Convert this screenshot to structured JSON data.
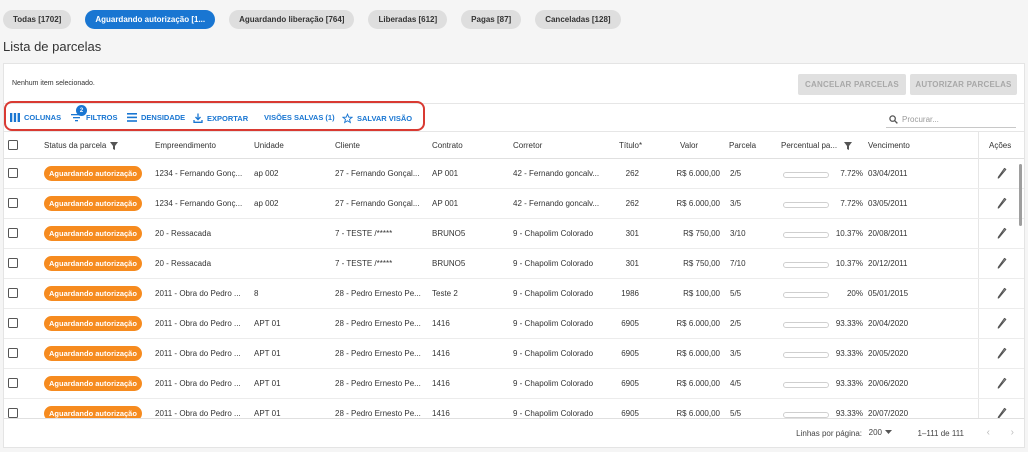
{
  "tabs": [
    {
      "label": "Todas [1702]",
      "active": false
    },
    {
      "label": "Aguardando autorização [1...",
      "active": true
    },
    {
      "label": "Aguardando liberação [764]",
      "active": false
    },
    {
      "label": "Liberadas [612]",
      "active": false
    },
    {
      "label": "Pagas [87]",
      "active": false
    },
    {
      "label": "Canceladas [128]",
      "active": false
    }
  ],
  "page_title": "Lista de parcelas",
  "selection": {
    "message": "Nenhum item selecionado.",
    "cancel_label": "CANCELAR PARCELAS",
    "authorize_label": "AUTORIZAR PARCELAS"
  },
  "toolbar": {
    "columns_label": "COLUNAS",
    "filters_label": "FILTROS",
    "filters_count": "2",
    "density_label": "DENSIDADE",
    "export_label": "EXPORTAR",
    "saved_views_label": "VISÕES SALVAS (1)",
    "save_view_label": "SALVAR VISÃO",
    "search_placeholder": "Procurar..."
  },
  "table": {
    "columns": [
      "Status da parcela",
      "Empreendimento",
      "Unidade",
      "Cliente",
      "Contrato",
      "Corretor",
      "Título*",
      "Valor",
      "Parcela",
      "Percentual pa...",
      "Vencimento",
      "Ações"
    ],
    "rows": [
      {
        "status": "Aguardando autorização",
        "empreendimento": "1234 - Fernando Gonç...",
        "unidade": "ap 002",
        "cliente": "27 - Fernando Gonçal...",
        "contrato": "AP 001",
        "corretor": "42 - Fernando goncalv...",
        "titulo": "262",
        "valor": "R$ 6.000,00",
        "parcela": "2/5",
        "percentual": "7.72%",
        "pct": 0.0772,
        "vencimento": "03/04/2011"
      },
      {
        "status": "Aguardando autorização",
        "empreendimento": "1234 - Fernando Gonç...",
        "unidade": "ap 002",
        "cliente": "27 - Fernando Gonçal...",
        "contrato": "AP 001",
        "corretor": "42 - Fernando goncalv...",
        "titulo": "262",
        "valor": "R$ 6.000,00",
        "parcela": "3/5",
        "percentual": "7.72%",
        "pct": 0.0772,
        "vencimento": "03/05/2011"
      },
      {
        "status": "Aguardando autorização",
        "empreendimento": "20 - Ressacada",
        "unidade": "",
        "cliente": "7 - TESTE /*****",
        "contrato": "BRUNO5",
        "corretor": "9 - Chapolim Colorado",
        "titulo": "301",
        "valor": "R$ 750,00",
        "parcela": "3/10",
        "percentual": "10.37%",
        "pct": 0.1037,
        "vencimento": "20/08/2011"
      },
      {
        "status": "Aguardando autorização",
        "empreendimento": "20 - Ressacada",
        "unidade": "",
        "cliente": "7 - TESTE /*****",
        "contrato": "BRUNO5",
        "corretor": "9 - Chapolim Colorado",
        "titulo": "301",
        "valor": "R$ 750,00",
        "parcela": "7/10",
        "percentual": "10.37%",
        "pct": 0.1037,
        "vencimento": "20/12/2011"
      },
      {
        "status": "Aguardando autorização",
        "empreendimento": "2011 - Obra do Pedro ...",
        "unidade": "8",
        "cliente": "28 - Pedro Ernesto Pe...",
        "contrato": "Teste 2",
        "corretor": "9 - Chapolim Colorado",
        "titulo": "1986",
        "valor": "R$ 100,00",
        "parcela": "5/5",
        "percentual": "20%",
        "pct": 0.2,
        "vencimento": "05/01/2015"
      },
      {
        "status": "Aguardando autorização",
        "empreendimento": "2011 - Obra do Pedro ...",
        "unidade": "APT 01",
        "cliente": "28 - Pedro Ernesto Pe...",
        "contrato": "1416",
        "corretor": "9 - Chapolim Colorado",
        "titulo": "6905",
        "valor": "R$ 6.000,00",
        "parcela": "2/5",
        "percentual": "93.33%",
        "pct": 0.9333,
        "vencimento": "20/04/2020"
      },
      {
        "status": "Aguardando autorização",
        "empreendimento": "2011 - Obra do Pedro ...",
        "unidade": "APT 01",
        "cliente": "28 - Pedro Ernesto Pe...",
        "contrato": "1416",
        "corretor": "9 - Chapolim Colorado",
        "titulo": "6905",
        "valor": "R$ 6.000,00",
        "parcela": "3/5",
        "percentual": "93.33%",
        "pct": 0.9333,
        "vencimento": "20/05/2020"
      },
      {
        "status": "Aguardando autorização",
        "empreendimento": "2011 - Obra do Pedro ...",
        "unidade": "APT 01",
        "cliente": "28 - Pedro Ernesto Pe...",
        "contrato": "1416",
        "corretor": "9 - Chapolim Colorado",
        "titulo": "6905",
        "valor": "R$ 6.000,00",
        "parcela": "4/5",
        "percentual": "93.33%",
        "pct": 0.9333,
        "vencimento": "20/06/2020"
      },
      {
        "status": "Aguardando autorização",
        "empreendimento": "2011 - Obra do Pedro ...",
        "unidade": "APT 01",
        "cliente": "28 - Pedro Ernesto Pe...",
        "contrato": "1416",
        "corretor": "9 - Chapolim Colorado",
        "titulo": "6905",
        "valor": "R$ 6.000,00",
        "parcela": "5/5",
        "percentual": "93.33%",
        "pct": 0.9333,
        "vencimento": "20/07/2020"
      }
    ]
  },
  "footer": {
    "rows_per_page_label": "Linhas por página:",
    "rows_per_page_value": "200",
    "range": "1–111 de 111"
  },
  "colors": {
    "primary": "#1976d2",
    "status_orange": "#f68b1f",
    "progress_green": "#2ea043",
    "highlight_red": "#d93a32"
  },
  "icons": [
    "columns-icon",
    "filter-icon",
    "density-icon",
    "export-icon",
    "star-icon",
    "search-icon",
    "checkbox-icon",
    "edit-pencil-icon",
    "dropdown-caret-icon",
    "chevron-left-icon",
    "chevron-right-icon"
  ]
}
